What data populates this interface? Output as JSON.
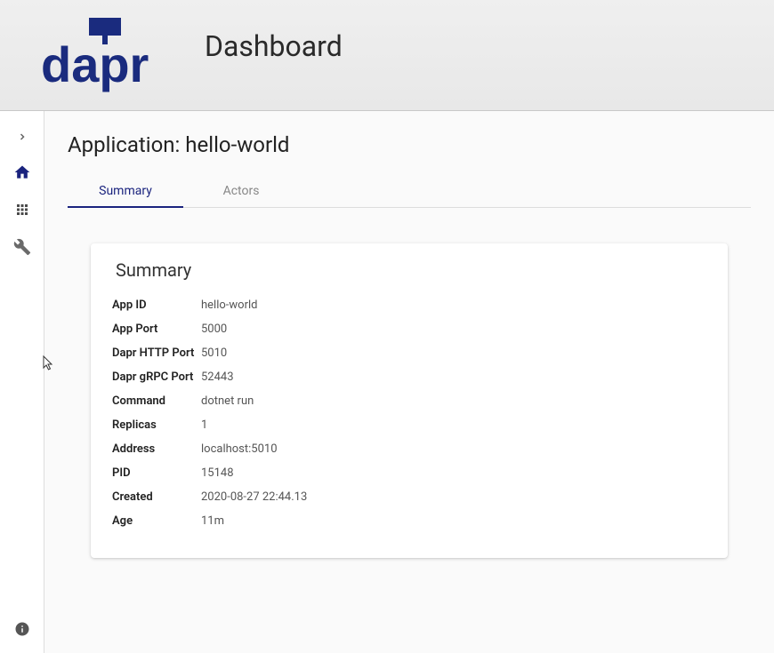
{
  "header": {
    "title": "Dashboard"
  },
  "page": {
    "title_prefix": "Application: ",
    "app_name": "hello-world"
  },
  "tabs": [
    {
      "label": "Summary",
      "active": true
    },
    {
      "label": "Actors",
      "active": false
    }
  ],
  "card": {
    "title": "Summary"
  },
  "summary": {
    "rows": [
      {
        "label": "App ID",
        "value": "hello-world"
      },
      {
        "label": "App Port",
        "value": "5000"
      },
      {
        "label": "Dapr HTTP Port",
        "value": "5010"
      },
      {
        "label": "Dapr gRPC Port",
        "value": "52443"
      },
      {
        "label": "Command",
        "value": "dotnet run"
      },
      {
        "label": "Replicas",
        "value": "1"
      },
      {
        "label": "Address",
        "value": "localhost:5010"
      },
      {
        "label": "PID",
        "value": "15148"
      },
      {
        "label": "Created",
        "value": "2020-08-27 22:44.13"
      },
      {
        "label": "Age",
        "value": "11m"
      }
    ]
  },
  "colors": {
    "brand": "#1a237e",
    "accent": "#1a237e"
  }
}
